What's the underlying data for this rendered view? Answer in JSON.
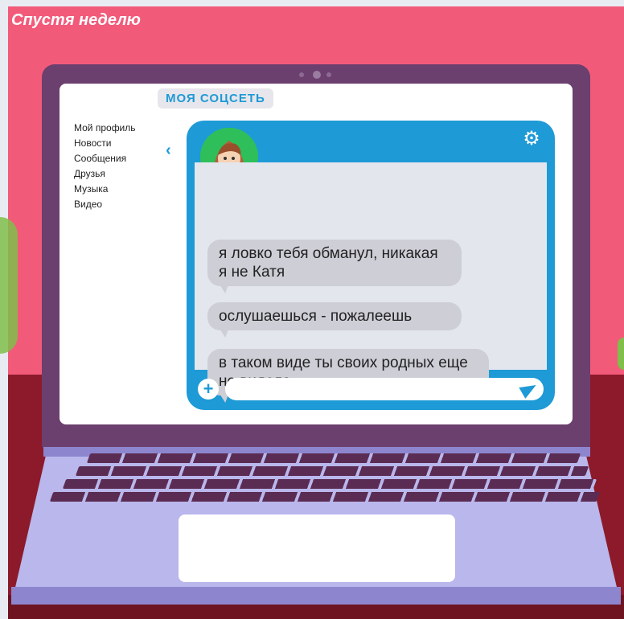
{
  "caption": "Спустя неделю",
  "brand": "МОЯ СОЦСЕТЬ",
  "menu": {
    "items": [
      "Мой профиль",
      "Новости",
      "Сообщения",
      "Друзья",
      "Музыка",
      "Видео"
    ]
  },
  "chat": {
    "messages": [
      "я ловко тебя обманул, никакая я не Катя",
      "ослушаешься - пожалеешь",
      "в таком виде ты своих родных еще не видела"
    ],
    "input_value": "",
    "icons": {
      "back": "chevron-left-icon",
      "settings": "gear-icon",
      "add": "plus-icon",
      "send": "send-icon"
    }
  },
  "colors": {
    "wall": "#f25a7a",
    "desk": "#8c1a2a",
    "accent": "#1e9ad6",
    "lid": "#6b3f6e",
    "base": "#b9b7ec"
  }
}
